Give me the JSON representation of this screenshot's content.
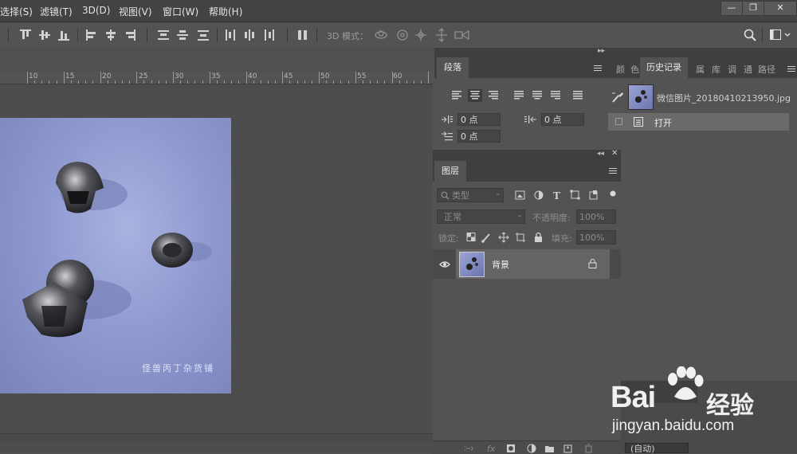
{
  "menu": {
    "items": [
      "选择(S)",
      "滤镜(T)",
      "3D(D)",
      "视图(V)",
      "窗口(W)",
      "帮助(H)"
    ]
  },
  "window_controls": {
    "minimize": "—",
    "restore": "❐",
    "close": "✕"
  },
  "options_bar": {
    "mode_label": "3D 模式："
  },
  "ruler": {
    "labels": [
      "10",
      "15",
      "20",
      "25",
      "30",
      "35",
      "40",
      "45",
      "50",
      "55",
      "60"
    ]
  },
  "document": {
    "watermark": "怪兽丙丁杂货铺"
  },
  "paragraph_panel": {
    "tab": "段落",
    "indent_left": "0 点",
    "indent_right": "0 点",
    "first_line": "0 点"
  },
  "history_panel": {
    "tabs": [
      "颜",
      "色",
      "历史记录",
      "属",
      "库",
      "调",
      "通",
      "路径"
    ],
    "active_tab": "历史记录",
    "snapshot_name": "微信图片_20180410213950.jpg",
    "items": [
      "打开"
    ]
  },
  "layers_panel": {
    "tab": "图层",
    "filter_placeholder": "类型",
    "blend_mode": "正常",
    "opacity_label": "不透明度:",
    "opacity_value": "100%",
    "lock_label": "锁定:",
    "fill_label": "填充:",
    "fill_value": "100%",
    "layers": [
      {
        "name": "背景",
        "visible": true,
        "locked": true
      }
    ]
  },
  "bottom_right": {
    "auto_label": "(自动)"
  },
  "watermark_site": {
    "brand": "Bai",
    "brand2": "经验",
    "url": "jingyan.baidu.com"
  },
  "colors": {
    "accent_blue": "#2f5fcf",
    "panel_bg": "#535353",
    "menubar_bg": "#434343"
  }
}
